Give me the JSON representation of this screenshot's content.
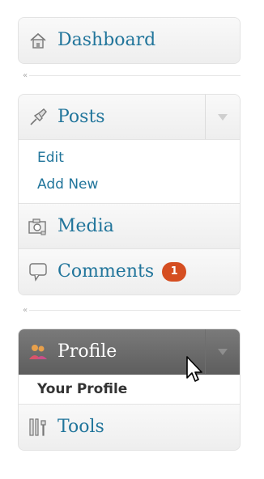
{
  "menu": {
    "dashboard": {
      "label": "Dashboard",
      "icon": "home-icon"
    },
    "posts": {
      "label": "Posts",
      "icon": "pushpin-icon",
      "submenu": [
        "Edit",
        "Add New"
      ]
    },
    "media": {
      "label": "Media",
      "icon": "camera-icon"
    },
    "comments": {
      "label": "Comments",
      "icon": "speech-bubble-icon",
      "badge": "1"
    },
    "profile": {
      "label": "Profile",
      "icon": "users-icon",
      "submenu": [
        "Your Profile"
      ]
    },
    "tools": {
      "label": "Tools",
      "icon": "tools-icon"
    }
  },
  "colors": {
    "link": "#21759b",
    "badge": "#d54e21",
    "active_header": "#6b6b6b"
  }
}
